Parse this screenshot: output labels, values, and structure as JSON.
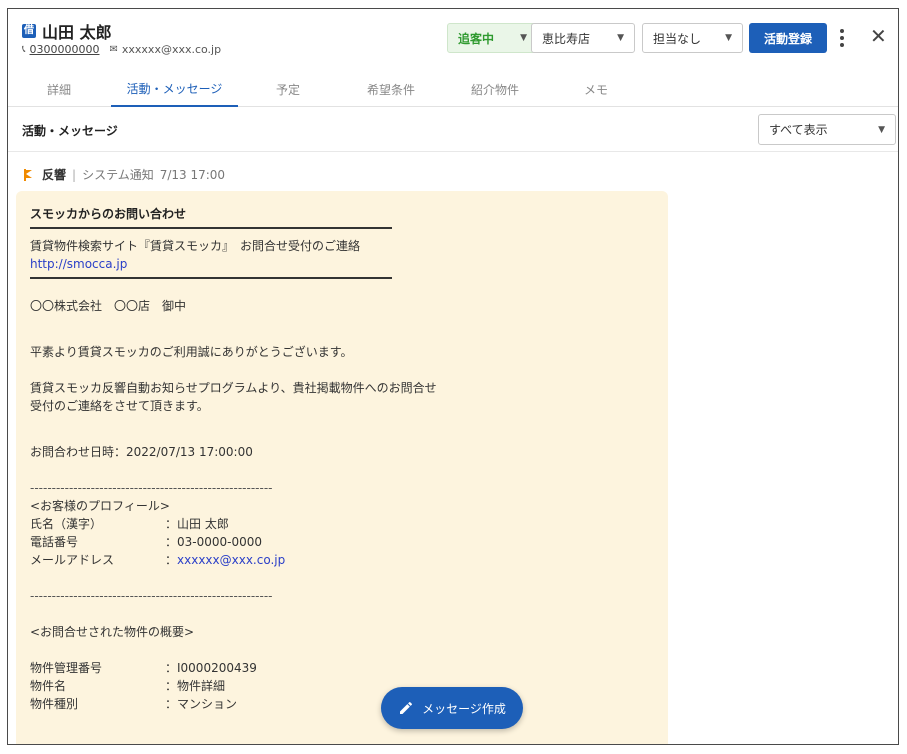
{
  "header": {
    "badge": "借",
    "customer_name": "山田 太郎",
    "phone": "0300000000",
    "email": "xxxxxx@xxx.co.jp",
    "status_label": "追客中",
    "store_label": "恵比寿店",
    "staff_label": "担当なし",
    "register_button": "活動登録",
    "close_symbol": "✕"
  },
  "tabs": [
    {
      "label": "詳細"
    },
    {
      "label": "活動・メッセージ"
    },
    {
      "label": "予定"
    },
    {
      "label": "希望条件"
    },
    {
      "label": "紹介物件"
    },
    {
      "label": "メモ"
    }
  ],
  "section": {
    "title": "活動・メッセージ",
    "filter_label": "すべて表示"
  },
  "activity": {
    "type": "反響",
    "sep": "|",
    "source": "システム通知",
    "time": "7/13 17:00"
  },
  "message": {
    "subject": "スモッカからのお問い合わせ",
    "site_line": "賃貸物件検索サイト『賃貸スモッカ』　お問合せ受付のご連絡",
    "url": "http://smocca.jp",
    "addressee": "〇〇株式会社　〇〇店　御中",
    "greeting": "平素より賃貸スモッカのご利用誠にありがとうございます。",
    "notice_1": "賃貸スモッカ反響自動お知らせプログラムより、貴社掲載物件へのお問合せ",
    "notice_2": "受付のご連絡をさせて頂きます。",
    "inquiry_datetime": "お問合わせ日時：2022/07/13 17:00:00",
    "dashes": "--------------------------------------------------------",
    "profile_heading": "<お客様のプロフィール>",
    "profile": [
      {
        "key": "氏名（漢字）",
        "value": "：山田 太郎"
      },
      {
        "key": "電話番号",
        "value": "：03-0000-0000"
      },
      {
        "key": "メールアドレス",
        "value": "：",
        "link": "xxxxxx@xxx.co.jp"
      }
    ],
    "property_heading": "<お問合せされた物件の概要>",
    "property": [
      {
        "key": "物件管理番号",
        "value": "：I0000200439"
      },
      {
        "key": "物件名",
        "value": "：物件詳細"
      },
      {
        "key": "物件種別",
        "value": "：マンション"
      }
    ]
  },
  "fab": {
    "label": "メッセージ作成"
  },
  "colors": {
    "primary": "#1d5fb8",
    "status_green": "#2f9a2f",
    "message_bg": "#fdf4de",
    "flag_orange": "#f08a00"
  }
}
